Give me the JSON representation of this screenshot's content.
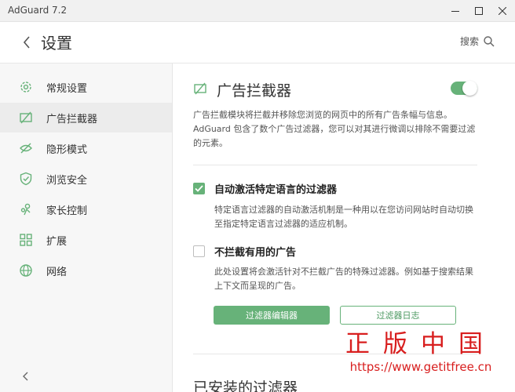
{
  "window": {
    "title": "AdGuard 7.2"
  },
  "header": {
    "page_title": "设置",
    "search_label": "搜索"
  },
  "sidebar": {
    "items": [
      {
        "label": "常规设置",
        "icon": "gear-icon"
      },
      {
        "label": "广告拦截器",
        "icon": "ad-blocker-icon"
      },
      {
        "label": "隐形模式",
        "icon": "eye-slash-icon"
      },
      {
        "label": "浏览安全",
        "icon": "shield-icon"
      },
      {
        "label": "家长控制",
        "icon": "parental-control-icon"
      },
      {
        "label": "扩展",
        "icon": "extensions-icon"
      },
      {
        "label": "网络",
        "icon": "globe-icon"
      }
    ],
    "active_index": 1
  },
  "main": {
    "section_title": "广告拦截器",
    "enabled": true,
    "description_1": "广告拦截模块将拦截并移除您浏览的网页中的所有广告条幅与信息。",
    "description_2": "AdGuard 包含了数个广告过滤器，您可以对其进行微调以排除不需要过滤",
    "description_3": "的元素。",
    "options": [
      {
        "label": "自动激活特定语言的过滤器",
        "checked": true,
        "desc_1": "特定语言过滤器的自动激活机制是一种用以在您访问网站时自动切换",
        "desc_2": "至指定特定语言过滤器的适应机制。"
      },
      {
        "label": "不拦截有用的广告",
        "checked": false,
        "desc_1": "此处设置将会激活针对不拦截广告的特殊过滤器。例如基于搜索结果",
        "desc_2": "上下文而呈现的广告。"
      }
    ],
    "filter_editor_button": "过滤器编辑器",
    "filter_log_button": "过滤器日志",
    "installed_filters_title": "已安装的过滤器"
  },
  "watermark": {
    "chinese": "正版中国",
    "url": "https://www.getitfree.cn"
  },
  "colors": {
    "accent": "#67b279",
    "watermark": "#d81e1e"
  }
}
